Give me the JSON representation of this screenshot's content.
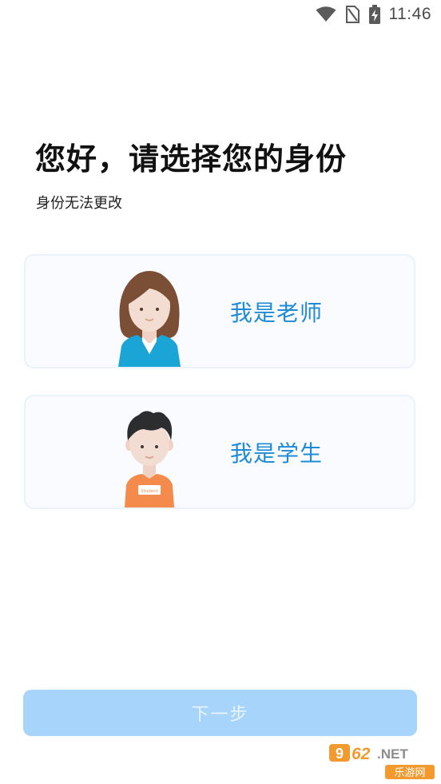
{
  "status_bar": {
    "time": "11:46",
    "icons": [
      "wifi-icon",
      "no-sim-icon",
      "battery-charging-icon"
    ]
  },
  "header": {
    "title": "您好，请选择您的身份",
    "subtitle": "身份无法更改"
  },
  "roles": [
    {
      "label": "我是老师",
      "avatar": "teacher-avatar"
    },
    {
      "label": "我是学生",
      "avatar": "student-avatar",
      "badge_text": "Student"
    }
  ],
  "footer": {
    "next_label": "下一步"
  },
  "watermark": {
    "number": "962",
    "suffix": ".NET",
    "tagline": "乐游网"
  },
  "colors": {
    "accent": "#1f8bd6",
    "button_disabled": "#a7d4fb",
    "card_border": "#eaf2fb",
    "card_background": "#f9fbfe"
  }
}
